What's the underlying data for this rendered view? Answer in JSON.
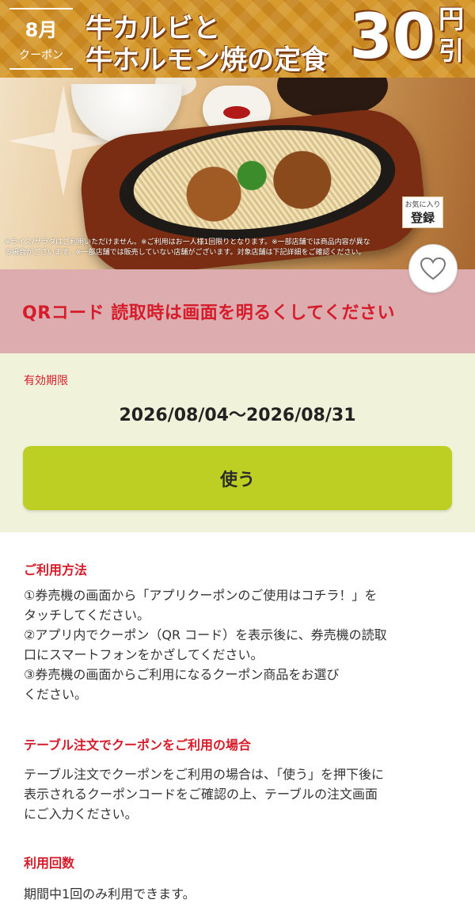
{
  "banner": {
    "month": "8月",
    "coupon_word": "クーポン",
    "title_line1": "牛カルビと",
    "title_line2": "牛ホルモン焼の定食",
    "discount_amount": "30",
    "discount_unit_top": "円",
    "discount_unit_bottom": "引",
    "fav_tag_small": "お気に入り",
    "fav_tag_big": "登録",
    "fineprint": "※ライス/サラダはご利用いただけません。※ご利用はお一人様1回限りとなります。※一部店舗では商品内容が異なる場合がございます。※一部店舗では販売していない店舗がございます。対象店舗は下記詳細をご確認ください。"
  },
  "favorite_button": {
    "icon": "heart-icon"
  },
  "qr_notice": {
    "text": "QRコード 読取時は画面を明るくしてください"
  },
  "validity": {
    "label": "有効期限",
    "dates": "2026/08/04〜2026/08/31"
  },
  "use_button": {
    "label": "使う"
  },
  "sections": [
    {
      "title": "ご利用方法",
      "lines": [
        "①券売機の画面から「アプリクーポンのご使用はコチラ！」を",
        "タッチしてください。",
        "②アプリ内でクーポン（QR コード）を表示後に、券売機の読取",
        "口にスマートフォンをかざしてください。",
        "③券売機の画面からご利用になるクーポン商品をお選び",
        "ください。"
      ]
    },
    {
      "title": "テーブル注文でクーポンをご利用の場合",
      "lines": [
        "テーブル注文でクーポンをご利用の場合は、「使う」を押下後に",
        "表示されるクーポンコードをご確認の上、テーブルの注文画面",
        "にご入力ください。"
      ]
    },
    {
      "title": "利用回数",
      "lines": [
        "期間中1回のみ利用できます。"
      ]
    }
  ],
  "colors": {
    "accent_red": "#d61c2a",
    "notice_bg": "#dcacaf",
    "validity_bg": "#f0f3da",
    "button_green": "#bccf22"
  }
}
